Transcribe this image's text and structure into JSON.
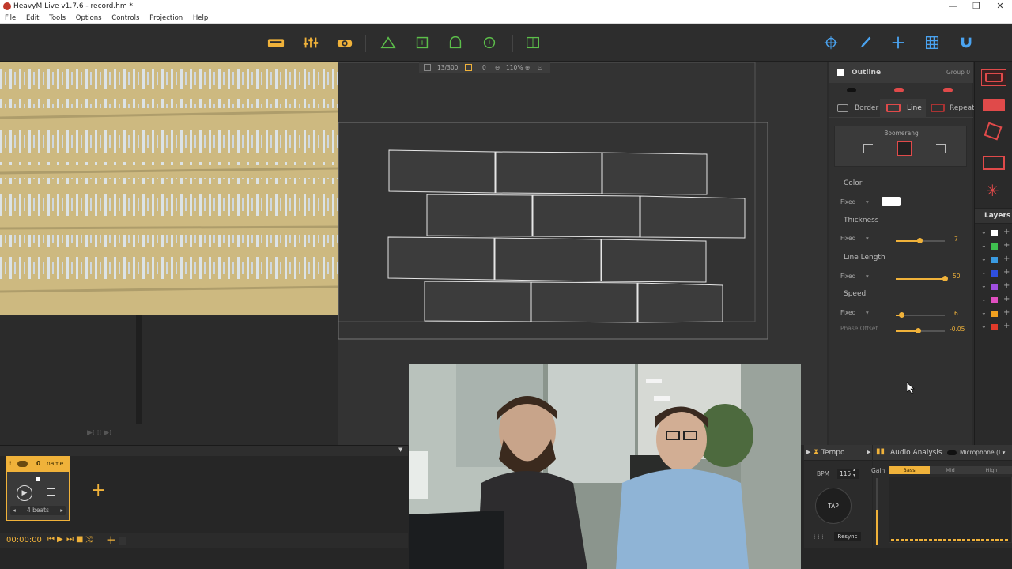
{
  "window": {
    "title": "HeavyM Live v1.7.6 - record.hm *",
    "minimize": "—",
    "maximize": "❐",
    "close": "✕"
  },
  "menu": [
    "File",
    "Edit",
    "Tools",
    "Options",
    "Controls",
    "Projection",
    "Help"
  ],
  "toolbar": {
    "left_icons": [
      "keyboard-icon",
      "sliders-icon",
      "projector-icon"
    ],
    "mid_icons": [
      "triangle-shape-icon",
      "square-shape-icon",
      "arch-shape-icon",
      "circle-shape-icon"
    ],
    "split_icon": "split-icon",
    "right_icons": [
      "target-icon",
      "brush-icon",
      "plus-icon",
      "grid-icon",
      "magnet-icon"
    ]
  },
  "zoombar": {
    "counter": "13/300",
    "selection": "0",
    "zoom": "110%"
  },
  "outline": {
    "title": "Outline",
    "group": "Group 0",
    "tabs": [
      "Border",
      "Line",
      "Repeat"
    ]
  },
  "boomerang": {
    "label": "Boomerang"
  },
  "params": {
    "color": {
      "label": "Color",
      "mode": "Fixed",
      "swatch": "#ffffff"
    },
    "thickness": {
      "label": "Thickness",
      "mode": "Fixed",
      "value": "7",
      "fraction": 0.48
    },
    "line_length": {
      "label": "Line Length",
      "mode": "Fixed",
      "value": "50",
      "fraction": 1.0
    },
    "speed": {
      "label": "Speed",
      "mode": "Fixed",
      "value": "6",
      "fraction": 0.12
    },
    "phase_offset": {
      "label": "Phase Offset",
      "value": "-0.05",
      "fraction": 0.45
    }
  },
  "layers": {
    "title": "Layers",
    "colors": [
      "#ffffff",
      "#3fbf4f",
      "#3a9ae0",
      "#2f4fe0",
      "#a04fe0",
      "#e04fc0",
      "#f0a020",
      "#e03a2a"
    ]
  },
  "clip": {
    "number": "0",
    "name": "name",
    "beats": "4 beats"
  },
  "transport": {
    "time": "00:00:00"
  },
  "tempo": {
    "title": "Tempo",
    "bpm_label": "BPM",
    "bpm": "115",
    "tap": "TAP",
    "resync": "Resync"
  },
  "audio": {
    "title": "Audio Analysis",
    "source": "Microphone (I",
    "gain": "Gain",
    "bands": [
      "Bass",
      "Mid",
      "High"
    ]
  },
  "add_clip": "+"
}
